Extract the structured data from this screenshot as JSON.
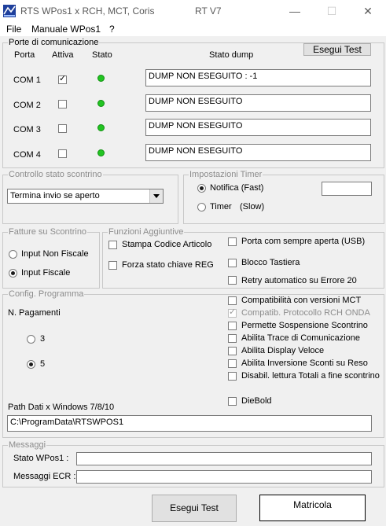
{
  "window": {
    "title": "RTS WPos1 x RCH, MCT, Coris",
    "version": "RT V7",
    "controls": {
      "minimize": "—",
      "maximize": "☐",
      "close": "✕"
    }
  },
  "menu": {
    "file": "File",
    "manual": "Manuale WPos1",
    "help": "?"
  },
  "ports": {
    "legend": "Porte di comunicazione",
    "test_button": "Esegui Test",
    "headers": {
      "port": "Porta",
      "active": "Attiva",
      "status": "Stato",
      "dump": "Stato dump"
    },
    "rows": [
      {
        "name": "COM 1",
        "active": true,
        "status": "green",
        "dump": "DUMP NON ESEGUITO : -1"
      },
      {
        "name": "COM 2",
        "active": false,
        "status": "green",
        "dump": "DUMP NON ESEGUITO"
      },
      {
        "name": "COM 3",
        "active": false,
        "status": "green",
        "dump": "DUMP NON ESEGUITO"
      },
      {
        "name": "COM 4",
        "active": false,
        "status": "green",
        "dump": "DUMP NON ESEGUITO"
      }
    ]
  },
  "receipt_control": {
    "legend": "Controllo stato scontrino",
    "selected": "Termina invio se aperto"
  },
  "timer": {
    "legend": "Impostazioni Timer",
    "fast_label": "Notifica (Fast)",
    "slow_label": "Timer",
    "slow_suffix": "(Slow)",
    "selected": "fast",
    "value": ""
  },
  "invoices": {
    "legend": "Fatture su Scontrino",
    "non_fiscal": "Input Non Fiscale",
    "fiscal": "Input Fiscale",
    "selected": "fiscal"
  },
  "extra": {
    "legend": "Funzioni Aggiuntive",
    "stampa_codice": "Stampa Codice Articolo",
    "forza_stato": "Forza stato chiave REG",
    "porta_aperta": "Porta com sempre aperta (USB)",
    "blocco_tastiera": "Blocco Tastiera",
    "retry": "Retry automatico su Errore 20"
  },
  "config": {
    "legend": "Config. Programma",
    "payments_label": "N. Pagamenti",
    "payment_options": [
      "3",
      "5"
    ],
    "payment_selected": "5",
    "path_label": "Path Dati x Windows 7/8/10",
    "path_value": "C:\\ProgramData\\RTSWPOS1",
    "options": [
      {
        "label": "Compatibilità con versioni MCT",
        "checked": false,
        "disabled": false
      },
      {
        "label": "Compatib. Protocollo  RCH ONDA",
        "checked": true,
        "disabled": true
      },
      {
        "label": "Permette Sospensione Scontrino",
        "checked": false,
        "disabled": false
      },
      {
        "label": "Abilita Trace di Comunicazione",
        "checked": false,
        "disabled": false
      },
      {
        "label": "Abilita Display Veloce",
        "checked": false,
        "disabled": false
      },
      {
        "label": "Abilita Inversione Sconti su Reso",
        "checked": false,
        "disabled": false
      },
      {
        "label": "Disabil. lettura Totali a fine scontrino",
        "checked": false,
        "disabled": false
      }
    ],
    "diebold": "DieBold"
  },
  "messages": {
    "legend": "Messaggi",
    "status_label": "Stato  WPos1 :",
    "ecr_label": "Messaggi ECR :",
    "status_value": "",
    "ecr_value": ""
  },
  "footer": {
    "test_button": "Esegui Test",
    "serial_label": "Matricola"
  }
}
